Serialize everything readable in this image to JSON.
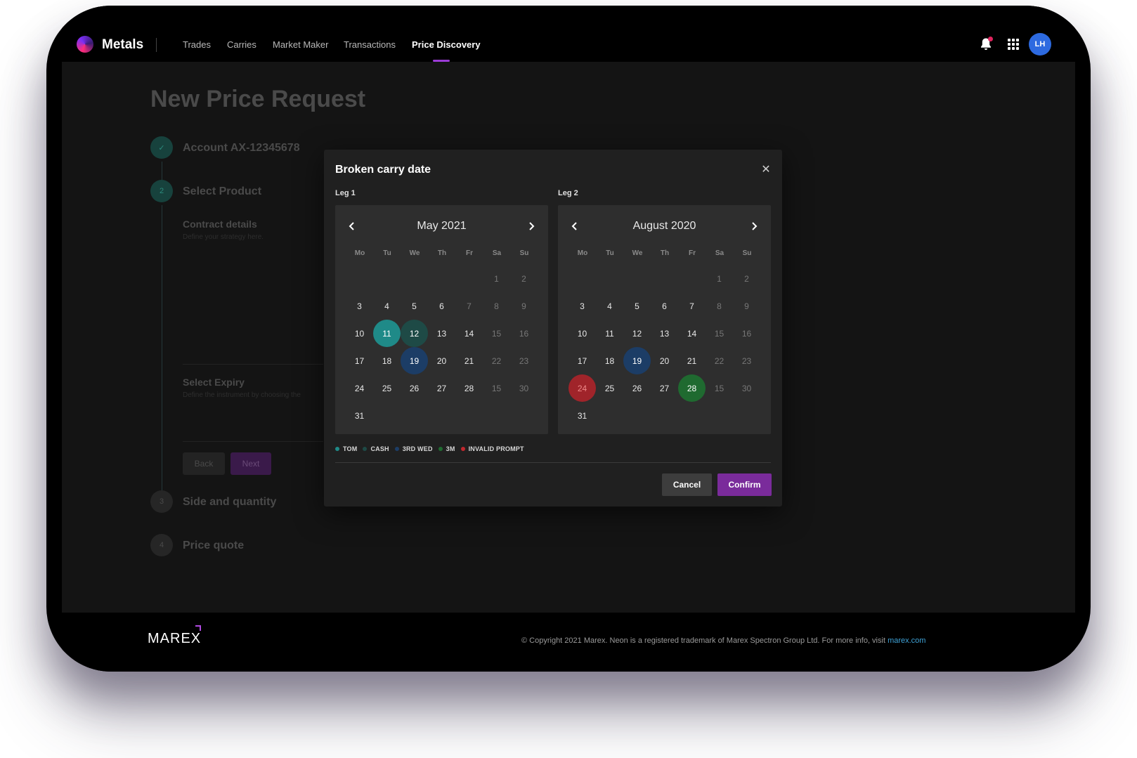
{
  "header": {
    "app_name": "Metals",
    "nav": [
      "Trades",
      "Carries",
      "Market Maker",
      "Transactions",
      "Price Discovery"
    ],
    "active_nav": "Price Discovery",
    "avatar_initials": "LH",
    "icons": {
      "notifications": "bell-icon",
      "apps": "apps-grid-icon"
    }
  },
  "page": {
    "title": "New Price Request",
    "steps": [
      {
        "number": "✓",
        "label": "Account AX-12345678",
        "state": "done"
      },
      {
        "number": "2",
        "label": "Select Product",
        "state": "active"
      },
      {
        "number": "3",
        "label": "Side and quantity",
        "state": "idle"
      },
      {
        "number": "4",
        "label": "Price quote",
        "state": "idle"
      }
    ],
    "contract_details": {
      "label": "Contract details",
      "hint": "Define your strategy here."
    },
    "select_expiry": {
      "label": "Select Expiry",
      "hint": "Define the instrument by choosing the"
    },
    "back_label": "Back",
    "next_label": "Next"
  },
  "modal": {
    "title": "Broken carry date",
    "close_icon": "close-icon",
    "legs": [
      {
        "label": "Leg 1",
        "month": "May 2021",
        "weekdays": [
          "Mo",
          "Tu",
          "We",
          "Th",
          "Fr",
          "Sa",
          "Su"
        ],
        "rows": [
          [
            "",
            "",
            "",
            "",
            "",
            "1",
            "2"
          ],
          [
            "3",
            "4",
            "5",
            "6",
            "7",
            "8",
            "9"
          ],
          [
            "10",
            "11",
            "12",
            "13",
            "14",
            "15",
            "16"
          ],
          [
            "17",
            "18",
            "19",
            "20",
            "21",
            "22",
            "23"
          ],
          [
            "24",
            "25",
            "26",
            "27",
            "28",
            "15",
            "30"
          ],
          [
            "31",
            "",
            "",
            "",
            "",
            "",
            ""
          ]
        ],
        "dim_days": [
          "7"
        ],
        "highlights": {
          "11": "tom",
          "12": "cash",
          "19": "3rd_wed"
        }
      },
      {
        "label": "Leg 2",
        "month": "August 2020",
        "weekdays": [
          "Mo",
          "Tu",
          "We",
          "Th",
          "Fr",
          "Sa",
          "Su"
        ],
        "rows": [
          [
            "",
            "",
            "",
            "",
            "",
            "1",
            "2"
          ],
          [
            "3",
            "4",
            "5",
            "6",
            "7",
            "8",
            "9"
          ],
          [
            "10",
            "11",
            "12",
            "13",
            "14",
            "15",
            "16"
          ],
          [
            "17",
            "18",
            "19",
            "20",
            "21",
            "22",
            "23"
          ],
          [
            "24",
            "25",
            "26",
            "27",
            "28",
            "15",
            "30"
          ],
          [
            "31",
            "",
            "",
            "",
            "",
            "",
            ""
          ]
        ],
        "dim_days": [],
        "highlights": {
          "19": "3rd_wed",
          "24": "invalid",
          "28": "3m"
        }
      }
    ],
    "legend": [
      {
        "key": "tom",
        "label": "TOM",
        "color": "#1f8a88"
      },
      {
        "key": "cash",
        "label": "CASH",
        "color": "#1e4a46"
      },
      {
        "key": "3rd_wed",
        "label": "3RD WED",
        "color": "#1c3d66"
      },
      {
        "key": "3m",
        "label": "3M",
        "color": "#1f6a30"
      },
      {
        "key": "invalid",
        "label": "INVALID PROMPT",
        "color": "#c0282e"
      }
    ],
    "highlight_colors": {
      "tom": "#1f8a88",
      "cash": "#1e4a46",
      "3rd_wed": "#1c3d66",
      "3m": "#1f6a30",
      "invalid": "#a0242a"
    },
    "cancel_label": "Cancel",
    "confirm_label": "Confirm"
  },
  "footer": {
    "brand": "MAREX",
    "copyright": "© Copyright 2021 Marex. Neon is a registered trademark of Marex Spectron Group Ltd. For more info, visit ",
    "link_text": "marex.com"
  }
}
